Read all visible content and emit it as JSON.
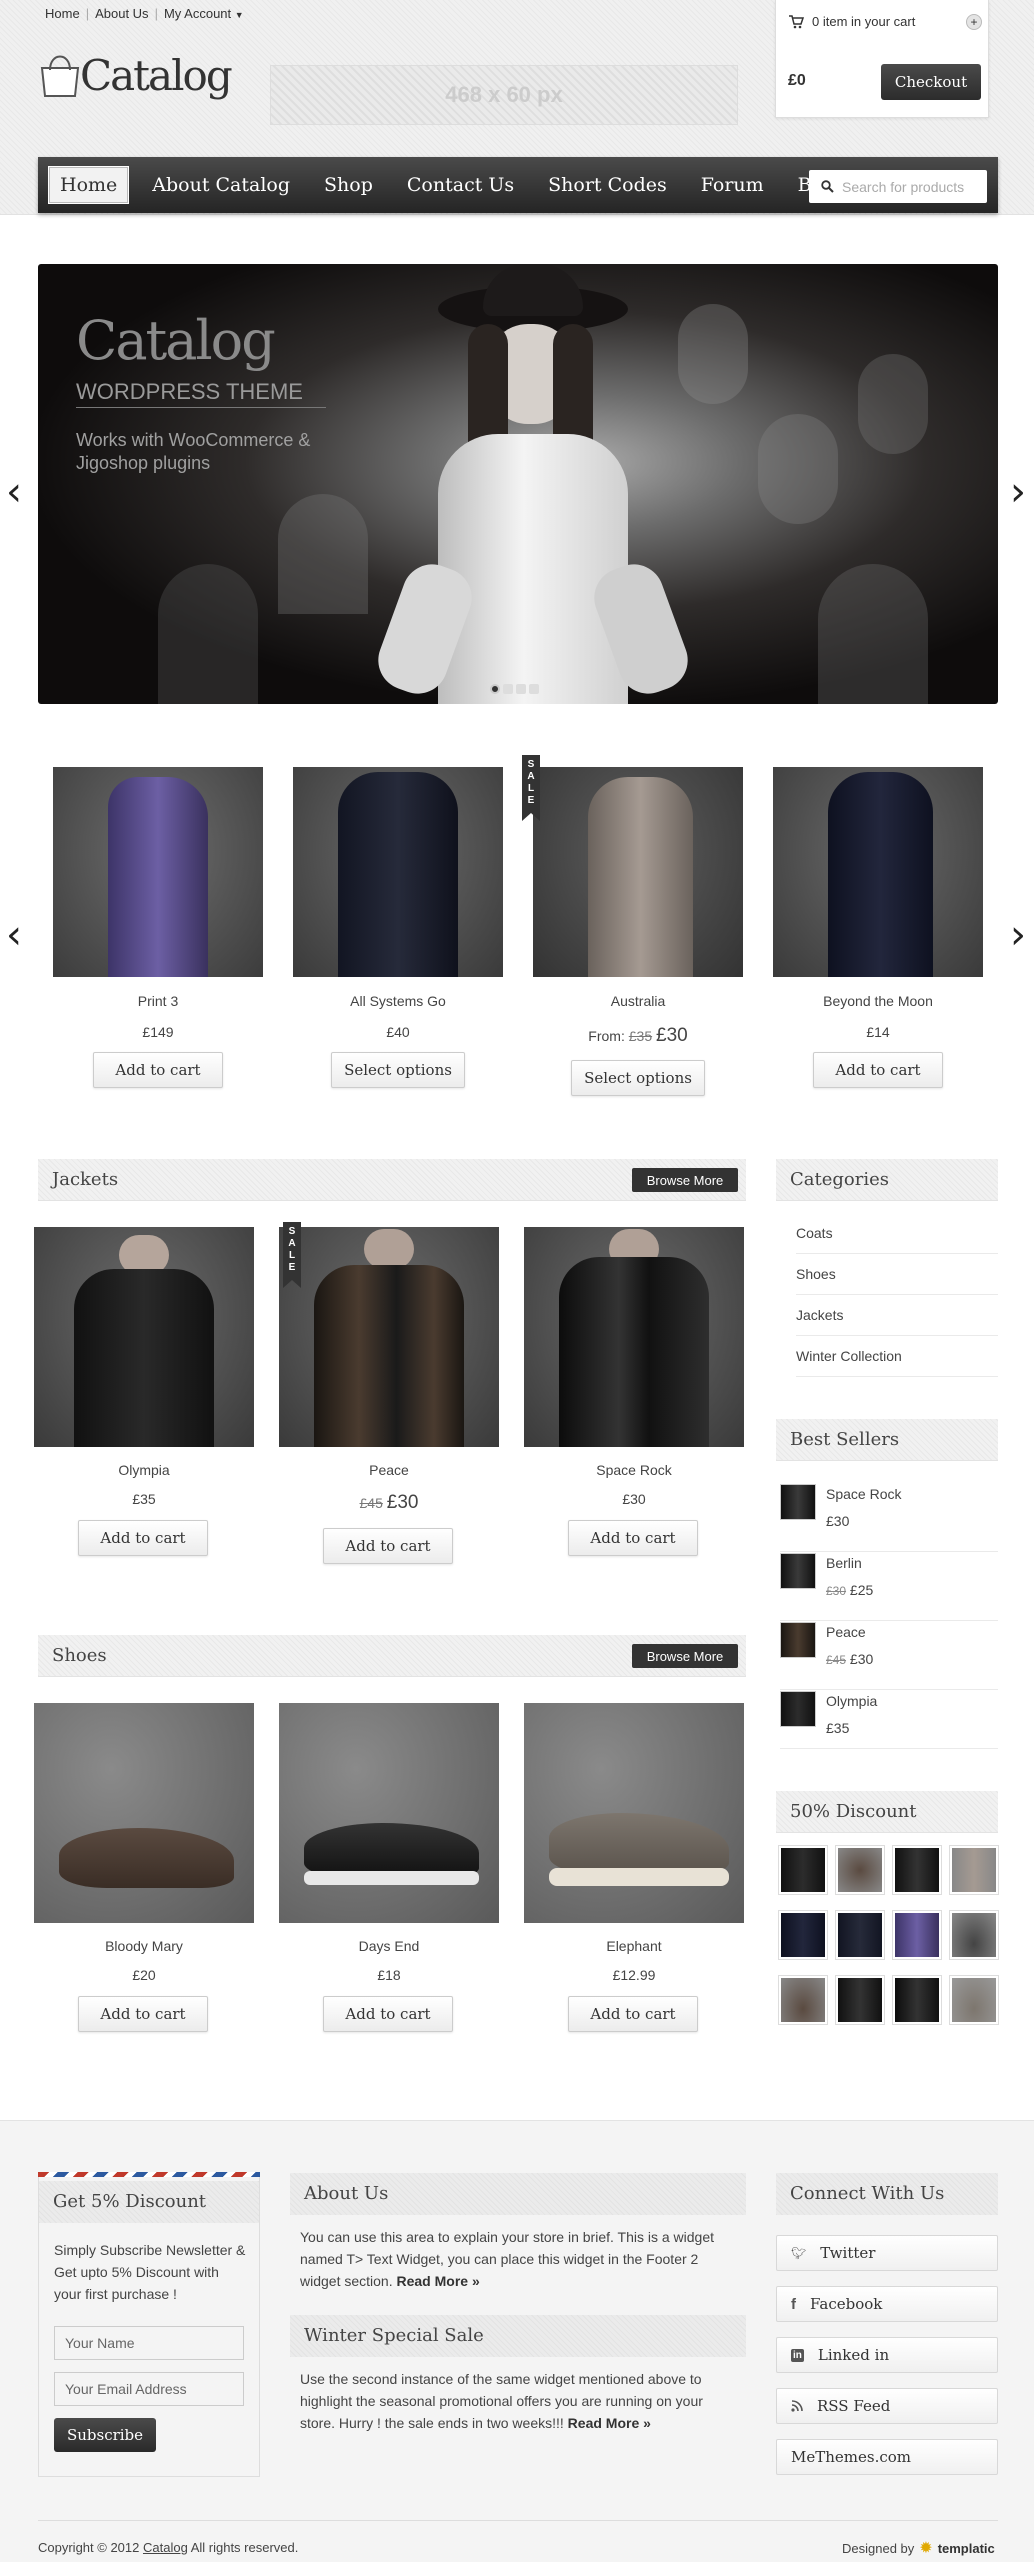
{
  "header": {
    "toplinks": [
      "Home",
      "About Us",
      "My Account"
    ],
    "cart": {
      "items_text": "0 item in your cart",
      "total": "£0",
      "checkout": "Checkout"
    },
    "logo_text": "Catalog",
    "ad_text": "468 x 60 px"
  },
  "nav": {
    "items": [
      "Home",
      "About Catalog",
      "Shop",
      "Contact Us",
      "Short Codes",
      "Forum",
      "Blog"
    ],
    "search_placeholder": "Search for products"
  },
  "slider": {
    "title": "Catalog",
    "subtitle": "WORDPRESS THEME",
    "tagline_1": "Works with WooCommerce &",
    "tagline_2": "Jigoshop plugins"
  },
  "featured": [
    {
      "name": "Print 3",
      "price": "£149",
      "button": "Add to cart"
    },
    {
      "name": "All Systems Go",
      "price": "£40",
      "button": "Select options"
    },
    {
      "name": "Australia",
      "price_prefix": "From:",
      "old_price": "£35",
      "price": "£30",
      "button": "Select options",
      "badge": "SALE"
    },
    {
      "name": "Beyond the Moon",
      "price": "£14",
      "button": "Add to cart"
    }
  ],
  "jackets": {
    "title": "Jackets",
    "browse": "Browse More",
    "products": [
      {
        "name": "Olympia",
        "price": "£35",
        "button": "Add to cart"
      },
      {
        "name": "Peace",
        "old_price": "£45",
        "price": "£30",
        "button": "Add to cart",
        "badge": "SALE"
      },
      {
        "name": "Space Rock",
        "price": "£30",
        "button": "Add to cart"
      }
    ]
  },
  "shoes": {
    "title": "Shoes",
    "browse": "Browse More",
    "products": [
      {
        "name": "Bloody Mary",
        "price": "£20",
        "button": "Add to cart"
      },
      {
        "name": "Days End",
        "price": "£18",
        "button": "Add to cart"
      },
      {
        "name": "Elephant",
        "price": "£12.99",
        "button": "Add to cart"
      }
    ]
  },
  "sidebar": {
    "categories_title": "Categories",
    "categories": [
      "Coats",
      "Shoes",
      "Jackets",
      "Winter Collection"
    ],
    "bestsellers_title": "Best Sellers",
    "bestsellers": [
      {
        "name": "Space Rock",
        "price": "£30"
      },
      {
        "name": "Berlin",
        "old_price": "£30",
        "price": "£25"
      },
      {
        "name": "Peace",
        "old_price": "£45",
        "price": "£30"
      },
      {
        "name": "Olympia",
        "price": "£35"
      }
    ],
    "discount_title": "50% Discount"
  },
  "footer": {
    "newsletter_title": "Get 5% Discount",
    "newsletter_text_1": "Simply Subscribe Newsletter &",
    "newsletter_text_2": "Get upto 5% Discount with",
    "newsletter_text_3": "your first purchase !",
    "name_placeholder": "Your Name",
    "email_placeholder": "Your Email Address",
    "subscribe": "Subscribe",
    "about_title": "About Us",
    "about_1": "You can use this area to explain your store in brief. This is a widget",
    "about_2": "named T> Text Widget, you can place this widget in the Footer 2",
    "about_3": "widget section.",
    "read_more": "Read More »",
    "winter_title": "Winter Special Sale",
    "winter_1": "Use the second instance of the same widget mentioned above to",
    "winter_2": "highlight the seasonal promotional offers you are running on your",
    "winter_3": "store. Hurry ! the sale ends in two weeks!!!",
    "connect_title": "Connect With Us",
    "social": [
      "Twitter",
      "Facebook",
      "Linked in",
      "RSS Feed",
      "MeThemes.com"
    ],
    "copyright_pre": "Copyright © 2012",
    "copyright_link": "Catalog",
    "copyright_post": "All rights reserved.",
    "designed_by": "Designed by",
    "designer": "templatic"
  },
  "colors": {
    "dark": "#333333",
    "nav": "#2e2e2e",
    "text": "#444444"
  }
}
